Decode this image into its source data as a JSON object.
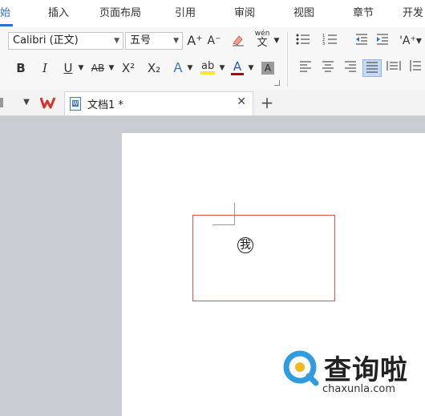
{
  "tabs": [
    {
      "label": "始",
      "active": true
    },
    {
      "label": "插入"
    },
    {
      "label": "页面布局"
    },
    {
      "label": "引用"
    },
    {
      "label": "审阅"
    },
    {
      "label": "视图"
    },
    {
      "label": "章节"
    },
    {
      "label": "开发"
    }
  ],
  "font": {
    "family": "Calibri (正文)",
    "size": "五号"
  },
  "format": {
    "bold": "B",
    "italic": "I",
    "underline": "U",
    "strike": "AB",
    "superscript": "X²",
    "subscript": "X₂",
    "grow": "A⁺",
    "shrink": "A⁻",
    "font_color_letter": "A"
  },
  "phonetic": {
    "top": "wén",
    "bottom": "文"
  },
  "document_tab": {
    "title": "文档1 *"
  },
  "page_text": {
    "char": "我"
  },
  "watermark": {
    "brand": "查询啦",
    "url": "chaxunla.com"
  },
  "colors": {
    "accent": "#2f6fc7",
    "wps_red": "#d9312b",
    "frame_red": "#e05050",
    "highlight": "#f7e53a",
    "font_color": "#c00000"
  }
}
